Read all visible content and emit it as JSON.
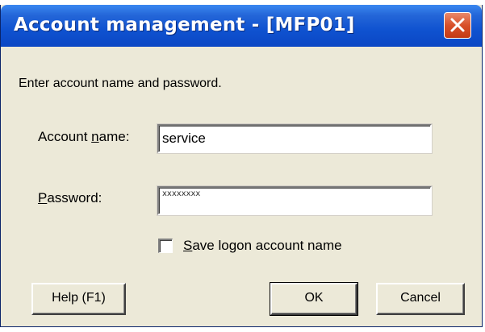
{
  "window": {
    "title": "Account management - [MFP01]"
  },
  "prompt": "Enter account name and password.",
  "account": {
    "label_pre": "Account ",
    "label_key": "n",
    "label_post": "ame:",
    "value": "service"
  },
  "password": {
    "label_key": "P",
    "label_post": "assword:",
    "mask": "xxxxxxxx"
  },
  "save_logon": {
    "label_key": "S",
    "label_post": "ave logon account name",
    "checked": false
  },
  "buttons": {
    "help": "Help (F1)",
    "ok": "OK",
    "cancel": "Cancel"
  },
  "colors": {
    "titlebar": "#0b47c4",
    "close": "#d8502a",
    "dialog_bg": "#ece9d8"
  }
}
